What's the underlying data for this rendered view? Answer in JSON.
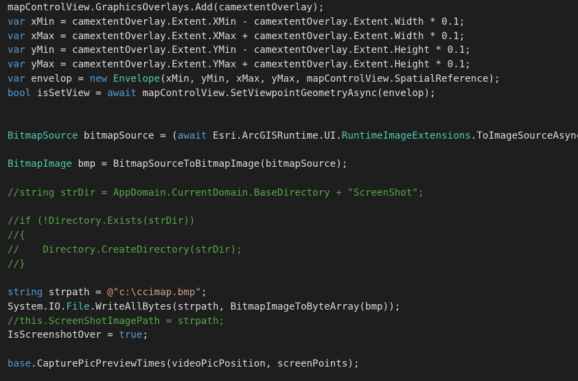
{
  "colors": {
    "background": "#1e1e1e",
    "plain": "#dcdcdc",
    "keyword": "#569cd6",
    "type": "#4ec9b0",
    "method": "#dcdcaa",
    "string": "#d69d85",
    "comment": "#57a64a"
  },
  "code_lines": [
    [
      {
        "t": "pl",
        "v": "mapControlView.GraphicsOverlays.Add(camextentOverlay);"
      }
    ],
    [
      {
        "t": "kw",
        "v": "var"
      },
      {
        "t": "pl",
        "v": " xMin = camextentOverlay.Extent.XMin - camextentOverlay.Extent.Width * 0.1;"
      }
    ],
    [
      {
        "t": "kw",
        "v": "var"
      },
      {
        "t": "pl",
        "v": " xMax = camextentOverlay.Extent.XMax + camextentOverlay.Extent.Width * 0.1;"
      }
    ],
    [
      {
        "t": "kw",
        "v": "var"
      },
      {
        "t": "pl",
        "v": " yMin = camextentOverlay.Extent.YMin - camextentOverlay.Extent.Height * 0.1;"
      }
    ],
    [
      {
        "t": "kw",
        "v": "var"
      },
      {
        "t": "pl",
        "v": " yMax = camextentOverlay.Extent.YMax + camextentOverlay.Extent.Height * 0.1;"
      }
    ],
    [
      {
        "t": "kw",
        "v": "var"
      },
      {
        "t": "pl",
        "v": " envelop = "
      },
      {
        "t": "kw",
        "v": "new"
      },
      {
        "t": "pl",
        "v": " "
      },
      {
        "t": "ty",
        "v": "Envelope"
      },
      {
        "t": "pl",
        "v": "(xMin, yMin, xMax, yMax, mapControlView.SpatialReference);"
      }
    ],
    [
      {
        "t": "kw",
        "v": "bool"
      },
      {
        "t": "pl",
        "v": " isSetView = "
      },
      {
        "t": "kw",
        "v": "await"
      },
      {
        "t": "pl",
        "v": " mapControlView.SetViewpointGeometryAsync(envelop);"
      }
    ],
    [],
    [],
    [
      {
        "t": "ty",
        "v": "BitmapSource"
      },
      {
        "t": "pl",
        "v": " bitmapSource = ("
      },
      {
        "t": "kw",
        "v": "await"
      },
      {
        "t": "pl",
        "v": " Esri.ArcGISRuntime.UI."
      },
      {
        "t": "ty",
        "v": "RuntimeImageExtensions"
      },
      {
        "t": "pl",
        "v": ".ToImageSourceAsync"
      }
    ],
    [],
    [
      {
        "t": "ty",
        "v": "BitmapImage"
      },
      {
        "t": "pl",
        "v": " bmp = BitmapSourceToBitmapImage(bitmapSource);"
      }
    ],
    [],
    [
      {
        "t": "cm",
        "v": "//string strDir = AppDomain.CurrentDomain.BaseDirectory + \"ScreenShot\";"
      }
    ],
    [],
    [
      {
        "t": "cm",
        "v": "//if (!Directory.Exists(strDir))"
      }
    ],
    [
      {
        "t": "cm",
        "v": "//{"
      }
    ],
    [
      {
        "t": "cm",
        "v": "//    Directory.CreateDirectory(strDir);"
      }
    ],
    [
      {
        "t": "cm",
        "v": "//}"
      }
    ],
    [],
    [
      {
        "t": "kw",
        "v": "string"
      },
      {
        "t": "pl",
        "v": " strpath = "
      },
      {
        "t": "st",
        "v": "@\"c:\\ccimap.bmp\""
      },
      {
        "t": "pl",
        "v": ";"
      }
    ],
    [
      {
        "t": "pl",
        "v": "System.IO."
      },
      {
        "t": "ty",
        "v": "File"
      },
      {
        "t": "pl",
        "v": ".WriteAllBytes(strpath, BitmapImageToByteArray(bmp));"
      }
    ],
    [
      {
        "t": "cm",
        "v": "//this.ScreenShotImagePath = strpath;"
      }
    ],
    [
      {
        "t": "pl",
        "v": "IsScreenshotOver = "
      },
      {
        "t": "kw",
        "v": "true"
      },
      {
        "t": "pl",
        "v": ";"
      }
    ],
    [],
    [
      {
        "t": "kw",
        "v": "base"
      },
      {
        "t": "pl",
        "v": ".CapturePicPreviewTimes(videoPicPosition, screenPoints);"
      }
    ]
  ]
}
